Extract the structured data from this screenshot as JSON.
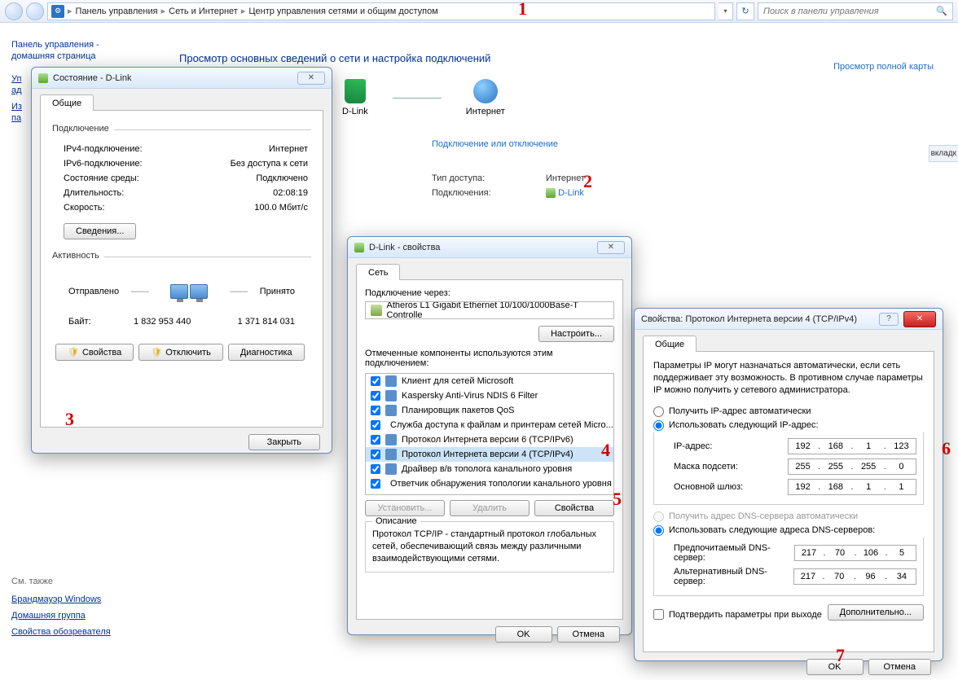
{
  "breadcrumbs": {
    "item1": "Панель управления",
    "item2": "Сеть и Интернет",
    "item3": "Центр управления сетями и общим доступом"
  },
  "search_placeholder": "Поиск в панели управления",
  "sidebar": {
    "home1": "Панель управления -",
    "home2": "домашняя страница",
    "link1_partial_1": "Уп",
    "link1_partial_2": "ад",
    "link2_partial": "Из",
    "link3_partial": "па",
    "seealso_title": "См. также",
    "seealso1": "Брандмауэр Windows",
    "seealso2": "Домашняя группа",
    "seealso3": "Свойства обозревателя"
  },
  "content": {
    "heading": "Просмотр основных сведений о сети и настройка подключений",
    "maplink": "Просмотр полной карты",
    "dlink_label": "D-Link",
    "internet_label": "Интернет",
    "connect_link": "Подключение или отключение",
    "row1_lbl": "Тип доступа:",
    "row1_val": "Интернет",
    "row2_lbl": "Подключения:",
    "row2_val": "D-Link"
  },
  "right_tab": "вкладк",
  "status": {
    "title": "Состояние - D-Link",
    "tab": "Общие",
    "grp_conn": "Подключение",
    "ipv4_lbl": "IPv4-подключение:",
    "ipv4_val": "Интернет",
    "ipv6_lbl": "IPv6-подключение:",
    "ipv6_val": "Без доступа к сети",
    "env_lbl": "Состояние среды:",
    "env_val": "Подключено",
    "dur_lbl": "Длительность:",
    "dur_val": "02:08:19",
    "speed_lbl": "Скорость:",
    "speed_val": "100.0 Мбит/с",
    "details_btn": "Сведения...",
    "grp_act": "Активность",
    "sent_lbl": "Отправлено",
    "recv_lbl": "Принято",
    "bytes_lbl": "Байт:",
    "bytes_sent": "1 832 953 440",
    "bytes_recv": "1 371 814 031",
    "props_btn": "Свойства",
    "disable_btn": "Отключить",
    "diag_btn": "Диагностика",
    "close_btn": "Закрыть"
  },
  "props": {
    "title": "D-Link - свойства",
    "tab": "Сеть",
    "connect_via": "Подключение через:",
    "adapter": "Atheros L1 Gigabit Ethernet 10/100/1000Base-T Controlle",
    "configure_btn": "Настроить...",
    "comps_label": "Отмеченные компоненты используются этим подключением:",
    "items": [
      "Клиент для сетей Microsoft",
      "Kaspersky Anti-Virus NDIS 6 Filter",
      "Планировщик пакетов QoS",
      "Служба доступа к файлам и принтерам сетей Micro...",
      "Протокол Интернета версии 6 (TCP/IPv6)",
      "Протокол Интернета версии 4 (TCP/IPv4)",
      "Драйвер в/в тополога канального уровня",
      "Ответчик обнаружения топологии канального уровня"
    ],
    "install_btn": "Установить...",
    "remove_btn": "Удалить",
    "properties_btn": "Свойства",
    "desc_lbl": "Описание",
    "desc_text": "Протокол TCP/IP - стандартный протокол глобальных сетей, обеспечивающий связь между различными взаимодействующими сетями.",
    "ok": "OK",
    "cancel": "Отмена"
  },
  "ip": {
    "title": "Свойства: Протокол Интернета версии 4 (TCP/IPv4)",
    "tab": "Общие",
    "intro": "Параметры IP могут назначаться автоматически, если сеть поддерживает эту возможность. В противном случае параметры IP можно получить у сетевого администратора.",
    "radio_auto_ip": "Получить IP-адрес автоматически",
    "radio_manual_ip": "Использовать следующий IP-адрес:",
    "ip_label": "IP-адрес:",
    "mask_label": "Маска подсети:",
    "gw_label": "Основной шлюз:",
    "ip_a": "192",
    "ip_b": "168",
    "ip_c": "1",
    "ip_d": "123",
    "mask_a": "255",
    "mask_b": "255",
    "mask_c": "255",
    "mask_d": "0",
    "gw_a": "192",
    "gw_b": "168",
    "gw_c": "1",
    "gw_d": "1",
    "radio_auto_dns": "Получить адрес DNS-сервера автоматически",
    "radio_manual_dns": "Использовать следующие адреса DNS-серверов:",
    "dns1_label": "Предпочитаемый DNS-сервер:",
    "dns2_label": "Альтернативный DNS-сервер:",
    "d1_a": "217",
    "d1_b": "70",
    "d1_c": "106",
    "d1_d": "5",
    "d2_a": "217",
    "d2_b": "70",
    "d2_c": "96",
    "d2_d": "34",
    "validate": "Подтвердить параметры при выходе",
    "advanced": "Дополнительно...",
    "ok": "OK",
    "cancel": "Отмена"
  },
  "annotations": {
    "n1": "1",
    "n2": "2",
    "n3": "3",
    "n4": "4",
    "n5": "5",
    "n6": "6",
    "n7": "7"
  }
}
